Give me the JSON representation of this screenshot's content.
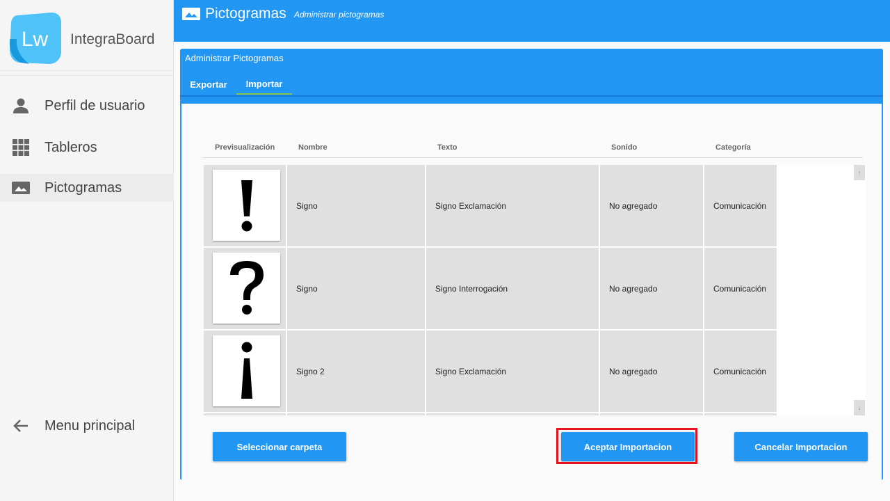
{
  "app": {
    "name": "IntegraBoard",
    "logo_text": "Lw"
  },
  "sidebar": {
    "items": [
      {
        "label": "Perfil de usuario",
        "icon": "person-icon"
      },
      {
        "label": "Tableros",
        "icon": "grid-icon"
      },
      {
        "label": "Pictogramas",
        "icon": "image-icon",
        "active": true
      }
    ],
    "bottom": {
      "label": "Menu principal",
      "icon": "arrow-left-icon"
    }
  },
  "topbar": {
    "title": "Pictogramas",
    "subtitle": "Administrar pictogramas"
  },
  "card": {
    "title": "Administrar Pictogramas",
    "tabs": [
      {
        "label": "Exportar",
        "active": false
      },
      {
        "label": "Importar",
        "active": true
      }
    ]
  },
  "table": {
    "columns": [
      "Previsualización",
      "Nombre",
      "Texto",
      "Sonido",
      "Categoría"
    ],
    "rows": [
      {
        "preview": "exclamation",
        "nombre": "Signo",
        "texto": "Signo Exclamación",
        "sonido": "No agregado",
        "categoria": "Comunicación"
      },
      {
        "preview": "question",
        "nombre": "Signo",
        "texto": "Signo Interrogación",
        "sonido": "No agregado",
        "categoria": "Comunicación"
      },
      {
        "preview": "inverted-exclamation",
        "nombre": "Signo 2",
        "texto": "Signo Exclamación",
        "sonido": "No agregado",
        "categoria": "Comunicación"
      }
    ]
  },
  "buttons": {
    "select_folder": "Seleccionar carpeta",
    "accept_import": "Aceptar Importacion",
    "cancel_import": "Cancelar Importacion"
  },
  "colors": {
    "primary": "#2196f3",
    "highlight": "#e5141f",
    "tab_indicator": "#8bc34a"
  }
}
